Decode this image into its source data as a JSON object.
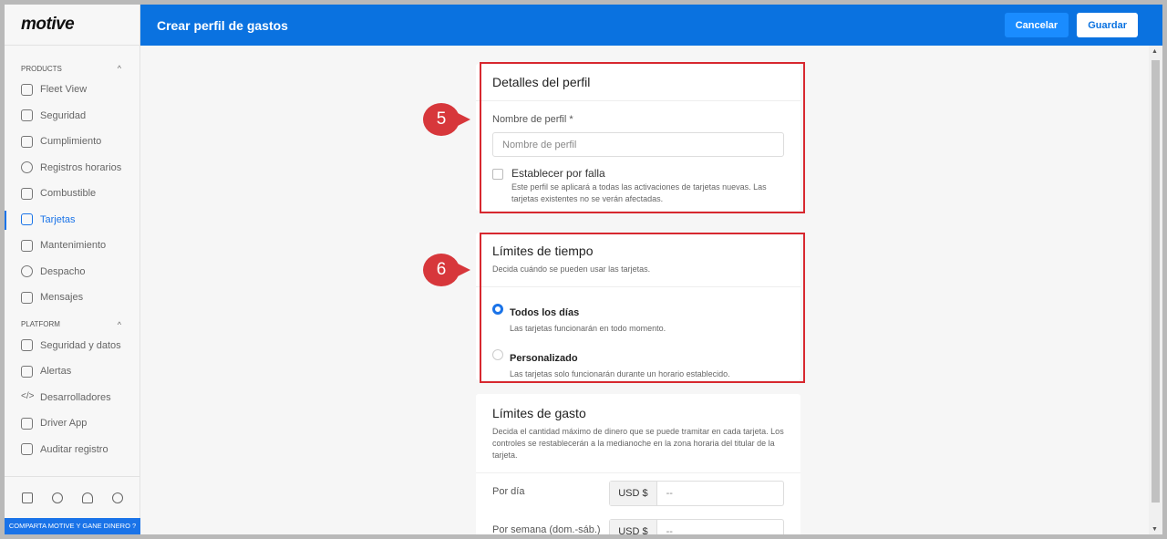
{
  "brand": "motive",
  "sidebar": {
    "products_label": "PRODUCTS",
    "platform_label": "PLATFORM",
    "products": [
      "Fleet View",
      "Seguridad",
      "Cumplimiento",
      "Registros horarios",
      "Combustible",
      "Tarjetas",
      "Mantenimiento",
      "Despacho",
      "Mensajes"
    ],
    "platform": [
      "Seguridad y datos",
      "Alertas",
      "Desarrolladores",
      "Driver App",
      "Auditar registro"
    ],
    "promo": "COMPARTA MOTIVE Y GANE DINERO ?"
  },
  "header": {
    "title": "Crear perfil de gastos",
    "cancel": "Cancelar",
    "save": "Guardar"
  },
  "profile": {
    "title": "Detalles del perfil",
    "name_label": "Nombre de perfil *",
    "name_placeholder": "Nombre de perfil",
    "default_label": "Establecer por falla",
    "default_desc": "Este perfil se aplicará a todas las activaciones de tarjetas nuevas. Las tarjetas existentes no se verán afectadas."
  },
  "time": {
    "title": "Límites de tiempo",
    "desc": "Decida cuándo se pueden usar las tarjetas.",
    "options": [
      {
        "label": "Todos los días",
        "desc": "Las tarjetas funcionarán en todo momento.",
        "selected": true
      },
      {
        "label": "Personalizado",
        "desc": "Las tarjetas solo funcionarán durante un horario establecido.",
        "selected": false
      }
    ]
  },
  "spend": {
    "title": "Límites de gasto",
    "desc": "Decida el cantidad máximo de dinero que se puede tramitar en cada tarjeta. Los controles se restablecerán a la medianoche en la zona horaria del titular de la tarjeta.",
    "rows": [
      {
        "label": "Por día",
        "currency": "USD $",
        "value": "--"
      },
      {
        "label": "Por semana (dom.-sáb.)",
        "currency": "USD $",
        "value": "--"
      }
    ]
  },
  "markers": [
    "5",
    "6"
  ],
  "colors": {
    "accent": "#0a72e0",
    "annotation": "#d7282f"
  }
}
